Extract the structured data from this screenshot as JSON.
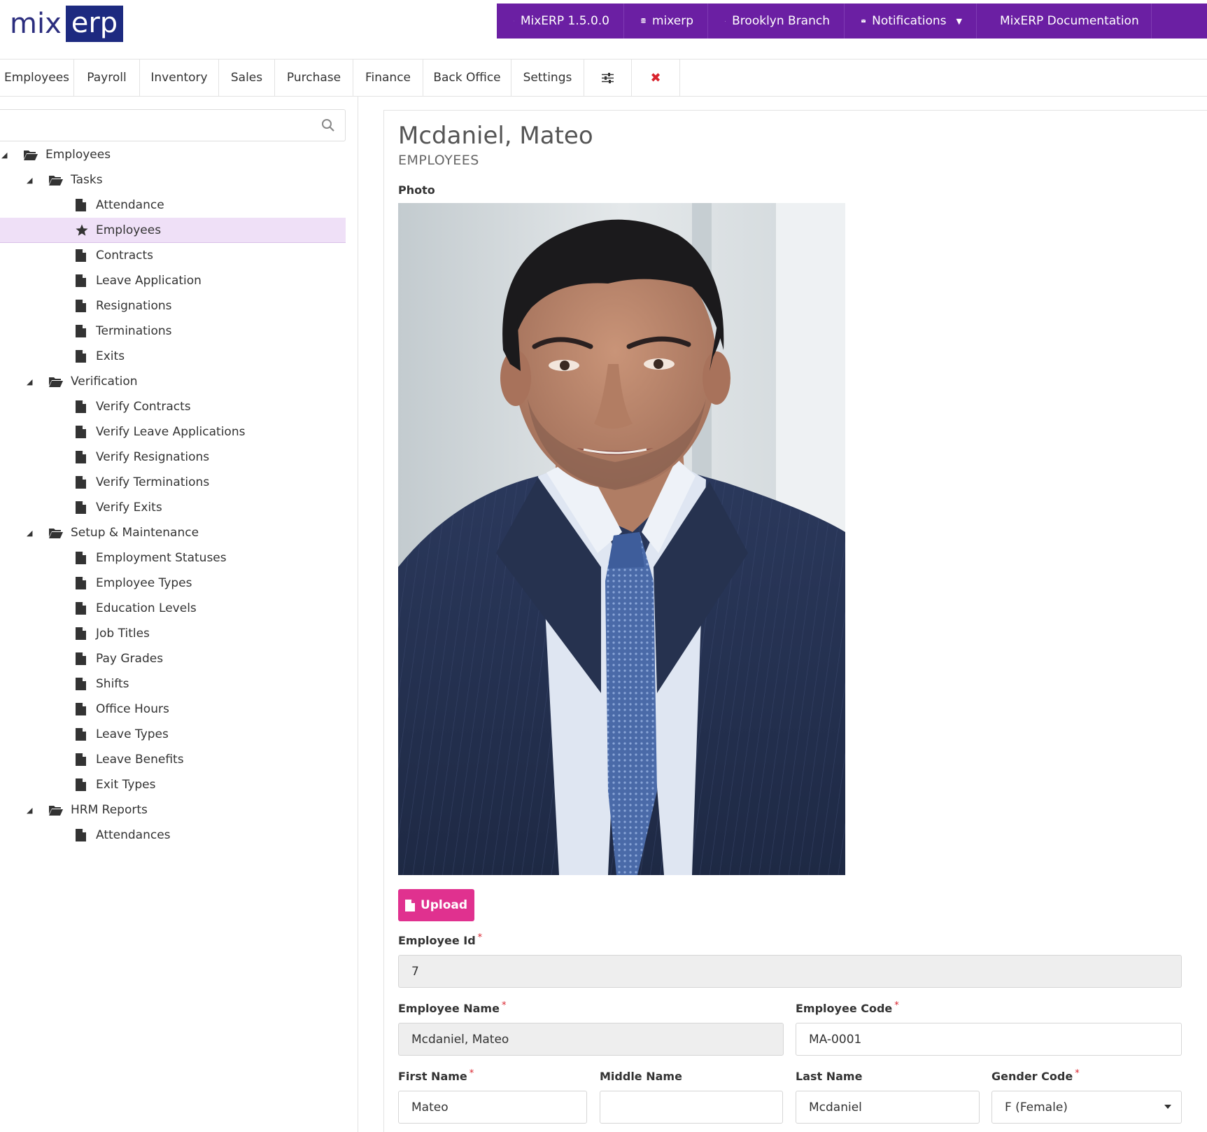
{
  "brand": {
    "mix": "mix",
    "erp": "erp"
  },
  "topnav": [
    {
      "icon": "anchor-icon",
      "label": "MixERP 1.5.0.0"
    },
    {
      "icon": "database-icon",
      "label": "mixerp"
    },
    {
      "icon": "home-icon",
      "label": "Brooklyn Branch"
    },
    {
      "icon": "envelope-icon",
      "label": "Notifications"
    },
    {
      "icon": "book-icon",
      "label": "MixERP Documentation"
    }
  ],
  "menu": [
    "Employees",
    "Payroll",
    "Inventory",
    "Sales",
    "Purchase",
    "Finance",
    "Back Office",
    "Settings"
  ],
  "menu_icons": {
    "settings_sliders": "sliders-icon",
    "close": "close-icon"
  },
  "search": {
    "placeholder": ""
  },
  "tree": [
    {
      "label": "Employees",
      "level": 0,
      "type": "folder"
    },
    {
      "label": "Tasks",
      "level": 1,
      "type": "folder"
    },
    {
      "label": "Attendance",
      "level": 2,
      "type": "doc"
    },
    {
      "label": "Employees",
      "level": 2,
      "type": "star",
      "active": true
    },
    {
      "label": "Contracts",
      "level": 2,
      "type": "doc"
    },
    {
      "label": "Leave Application",
      "level": 2,
      "type": "doc"
    },
    {
      "label": "Resignations",
      "level": 2,
      "type": "doc"
    },
    {
      "label": "Terminations",
      "level": 2,
      "type": "doc"
    },
    {
      "label": "Exits",
      "level": 2,
      "type": "doc"
    },
    {
      "label": "Verification",
      "level": 1,
      "type": "folder"
    },
    {
      "label": "Verify Contracts",
      "level": 2,
      "type": "doc"
    },
    {
      "label": "Verify Leave Applications",
      "level": 2,
      "type": "doc"
    },
    {
      "label": "Verify Resignations",
      "level": 2,
      "type": "doc"
    },
    {
      "label": "Verify Terminations",
      "level": 2,
      "type": "doc"
    },
    {
      "label": "Verify Exits",
      "level": 2,
      "type": "doc"
    },
    {
      "label": "Setup & Maintenance",
      "level": 1,
      "type": "folder"
    },
    {
      "label": "Employment Statuses",
      "level": 2,
      "type": "doc"
    },
    {
      "label": "Employee Types",
      "level": 2,
      "type": "doc"
    },
    {
      "label": "Education Levels",
      "level": 2,
      "type": "doc"
    },
    {
      "label": "Job Titles",
      "level": 2,
      "type": "doc"
    },
    {
      "label": "Pay Grades",
      "level": 2,
      "type": "doc"
    },
    {
      "label": "Shifts",
      "level": 2,
      "type": "doc"
    },
    {
      "label": "Office Hours",
      "level": 2,
      "type": "doc"
    },
    {
      "label": "Leave Types",
      "level": 2,
      "type": "doc"
    },
    {
      "label": "Leave Benefits",
      "level": 2,
      "type": "doc"
    },
    {
      "label": "Exit Types",
      "level": 2,
      "type": "doc"
    },
    {
      "label": "HRM Reports",
      "level": 1,
      "type": "folder"
    },
    {
      "label": "Attendances",
      "level": 2,
      "type": "doc"
    }
  ],
  "page": {
    "title": "Mcdaniel, Mateo",
    "subtitle": "EMPLOYEES"
  },
  "form": {
    "photo_label": "Photo",
    "upload_label": "Upload",
    "employee_id": {
      "label": "Employee Id",
      "value": "7"
    },
    "employee_name": {
      "label": "Employee Name",
      "value": "Mcdaniel, Mateo"
    },
    "employee_code": {
      "label": "Employee Code",
      "value": "MA-0001"
    },
    "first_name": {
      "label": "First Name",
      "value": "Mateo"
    },
    "middle_name": {
      "label": "Middle Name",
      "value": ""
    },
    "last_name": {
      "label": "Last Name",
      "value": "Mcdaniel"
    },
    "gender_code": {
      "label": "Gender Code",
      "value": "F (Female)"
    },
    "required_mark": "*"
  },
  "colors": {
    "topnav": "#6b1fa3",
    "upload": "#e0318f",
    "active_row": "#efe0f7",
    "close": "#d9232d"
  }
}
